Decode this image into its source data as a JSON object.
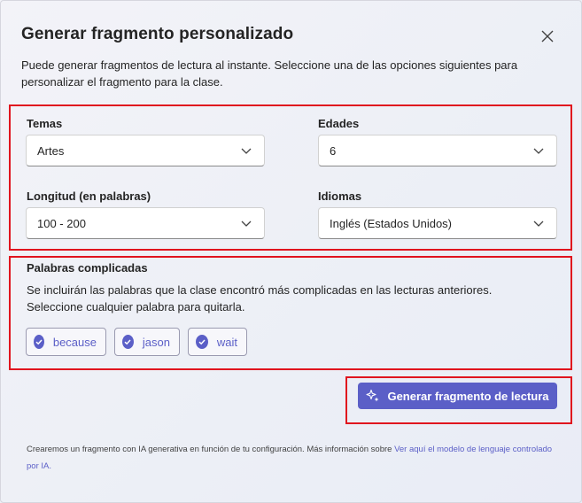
{
  "dialog": {
    "title": "Generar fragmento personalizado",
    "description": "Puede generar fragmentos de lectura al instante. Seleccione una de las opciones siguientes para personalizar el fragmento para la clase."
  },
  "fields": {
    "temas": {
      "label": "Temas",
      "value": "Artes"
    },
    "edades": {
      "label": "Edades",
      "value": "6"
    },
    "longitud": {
      "label": "Longitud (en palabras)",
      "value": "100 - 200"
    },
    "idiomas": {
      "label": "Idiomas",
      "value": "Inglés (Estados Unidos)"
    }
  },
  "difficult_words": {
    "title": "Palabras complicadas",
    "description": "Se incluirán las palabras que la clase encontró más complicadas en las lecturas anteriores. Seleccione cualquier palabra para quitarla.",
    "words": [
      "because",
      "jason",
      "wait"
    ]
  },
  "generate_button": {
    "label": "Generar fragmento de lectura",
    "icon": "sparkle-icon"
  },
  "footer": {
    "text": "Crearemos un fragmento con IA generativa en función de tu configuración. Más información sobre ",
    "link": "Ver aquí el modelo de lenguaje controlado por IA."
  },
  "colors": {
    "accent": "#5b5fc7",
    "highlight": "#e0141e"
  }
}
